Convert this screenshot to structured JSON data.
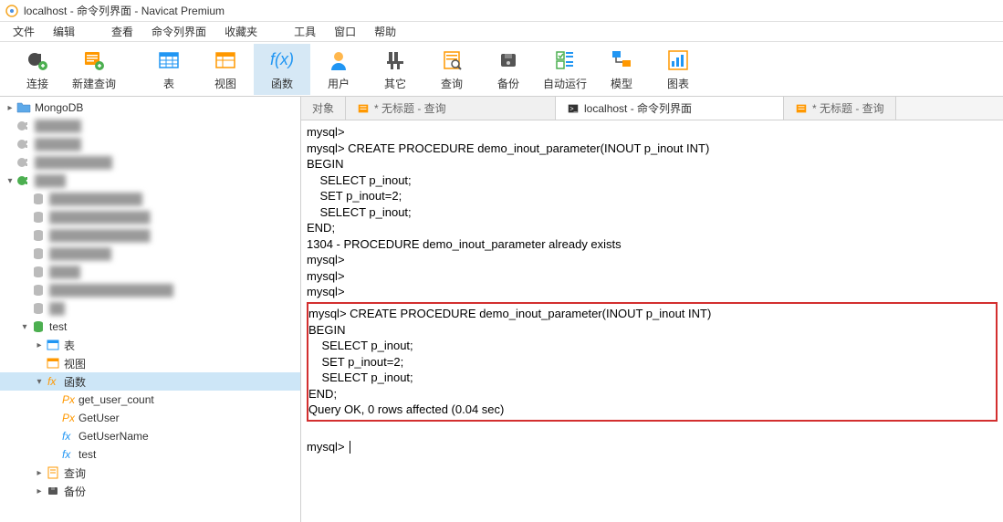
{
  "titlebar": {
    "text": "localhost - 命令列界面 - Navicat Premium"
  },
  "menu": {
    "items": [
      "文件",
      "编辑",
      "查看",
      "命令列界面",
      "收藏夹",
      "工具",
      "窗口",
      "帮助"
    ]
  },
  "toolbar": {
    "items": [
      {
        "label": "连接",
        "icon": "plug",
        "active": false
      },
      {
        "label": "新建查询",
        "icon": "new-query",
        "active": false
      },
      {
        "label": "表",
        "icon": "table",
        "active": false
      },
      {
        "label": "视图",
        "icon": "view",
        "active": false
      },
      {
        "label": "函数",
        "icon": "fx",
        "active": true
      },
      {
        "label": "用户",
        "icon": "user",
        "active": false
      },
      {
        "label": "其它",
        "icon": "other",
        "active": false
      },
      {
        "label": "查询",
        "icon": "query",
        "active": false
      },
      {
        "label": "备份",
        "icon": "backup",
        "active": false
      },
      {
        "label": "自动运行",
        "icon": "auto",
        "active": false
      },
      {
        "label": "模型",
        "icon": "model",
        "active": false
      },
      {
        "label": "图表",
        "icon": "chart",
        "active": false
      }
    ]
  },
  "sidebar": {
    "rows": [
      {
        "indent": 0,
        "toggle": ">",
        "icon": "folder",
        "label": "MongoDB",
        "blur": false
      },
      {
        "indent": 0,
        "toggle": "",
        "icon": "conn-off",
        "label": "██████",
        "blur": true
      },
      {
        "indent": 0,
        "toggle": "",
        "icon": "conn-off",
        "label": "██████",
        "blur": true
      },
      {
        "indent": 0,
        "toggle": "",
        "icon": "conn-off",
        "label": "██████████",
        "blur": true
      },
      {
        "indent": 0,
        "toggle": "v",
        "icon": "conn-on",
        "label": "████",
        "blur": true
      },
      {
        "indent": 1,
        "toggle": "",
        "icon": "db-off",
        "label": "████████████",
        "blur": true
      },
      {
        "indent": 1,
        "toggle": "",
        "icon": "db-off",
        "label": "█████████████",
        "blur": true
      },
      {
        "indent": 1,
        "toggle": "",
        "icon": "db-off",
        "label": "█████████████",
        "blur": true
      },
      {
        "indent": 1,
        "toggle": "",
        "icon": "db-off",
        "label": "████████",
        "blur": true
      },
      {
        "indent": 1,
        "toggle": "",
        "icon": "db-off",
        "label": "████",
        "blur": true
      },
      {
        "indent": 1,
        "toggle": "",
        "icon": "db-off",
        "label": "████████████████",
        "blur": true
      },
      {
        "indent": 1,
        "toggle": "",
        "icon": "db-off",
        "label": "██",
        "blur": true
      },
      {
        "indent": 1,
        "toggle": "v",
        "icon": "db-on",
        "label": "test",
        "blur": false
      },
      {
        "indent": 2,
        "toggle": ">",
        "icon": "table",
        "label": "表",
        "blur": false
      },
      {
        "indent": 2,
        "toggle": "",
        "icon": "view",
        "label": "视图",
        "blur": false
      },
      {
        "indent": 2,
        "toggle": "v",
        "icon": "fx",
        "label": "函数",
        "blur": false,
        "selected": true
      },
      {
        "indent": 3,
        "toggle": "",
        "icon": "px",
        "label": "get_user_count",
        "blur": false
      },
      {
        "indent": 3,
        "toggle": "",
        "icon": "px",
        "label": "GetUser",
        "blur": false
      },
      {
        "indent": 3,
        "toggle": "",
        "icon": "fx-blue",
        "label": "GetUserName",
        "blur": false
      },
      {
        "indent": 3,
        "toggle": "",
        "icon": "fx-blue",
        "label": "test",
        "blur": false
      },
      {
        "indent": 2,
        "toggle": ">",
        "icon": "query",
        "label": "查询",
        "blur": false
      },
      {
        "indent": 2,
        "toggle": ">",
        "icon": "backup",
        "label": "备份",
        "blur": false
      }
    ]
  },
  "tabs": {
    "items": [
      {
        "label": "对象",
        "icon": "",
        "active": false
      },
      {
        "label": "* 无标题 - 查询",
        "icon": "query-tab",
        "active": false
      },
      {
        "label": "localhost - 命令列界面",
        "icon": "cli-tab",
        "active": true
      },
      {
        "label": "* 无标题 - 查询",
        "icon": "query-tab",
        "active": false
      }
    ]
  },
  "console": {
    "before": [
      "mysql>",
      "mysql> CREATE PROCEDURE demo_inout_parameter(INOUT p_inout INT)",
      "BEGIN",
      "    SELECT p_inout;",
      "    SET p_inout=2;",
      "    SELECT p_inout;",
      "END;",
      "1304 - PROCEDURE demo_inout_parameter already exists",
      "mysql>",
      "mysql>",
      "mysql>"
    ],
    "highlight": [
      "mysql> CREATE PROCEDURE demo_inout_parameter(INOUT p_inout INT)",
      "BEGIN",
      "    SELECT p_inout;",
      "    SET p_inout=2;",
      "    SELECT p_inout;",
      "END;",
      "Query OK, 0 rows affected (0.04 sec)"
    ],
    "after_prompt": "mysql> "
  }
}
